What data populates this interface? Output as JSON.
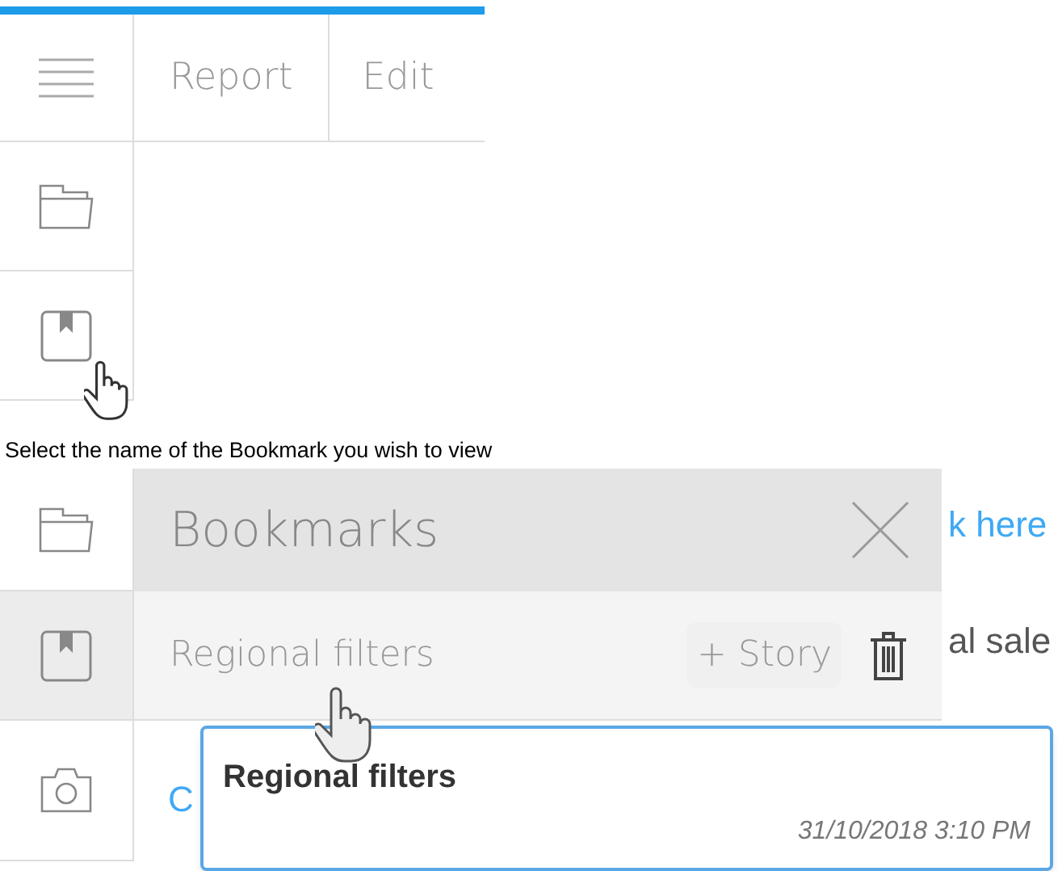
{
  "progress": {
    "level": 1
  },
  "toolbar": {
    "tabs": [
      {
        "label": "Report"
      },
      {
        "label": "Edit"
      }
    ]
  },
  "sidebar_1": [
    {
      "kind": "folder",
      "selected": false
    },
    {
      "kind": "bookmark",
      "selected": false
    }
  ],
  "instruction": "Select the name of the Bookmark you wish to view",
  "sidebar_2": [
    {
      "kind": "folder",
      "selected": false
    },
    {
      "kind": "bookmark",
      "selected": true
    },
    {
      "kind": "camera",
      "selected": false
    }
  ],
  "bookmarks_panel": {
    "title": "Bookmarks",
    "items": [
      {
        "name": "Regional filters",
        "button": "+ Story"
      }
    ]
  },
  "background_texts": [
    {
      "text": "k here",
      "kind": "link"
    },
    {
      "text": "al sale",
      "kind": "plain"
    },
    {
      "text": "C",
      "kind": "link"
    }
  ],
  "tooltip": {
    "title": "Regional filters",
    "date": "31/10/2018 3:10 PM"
  }
}
